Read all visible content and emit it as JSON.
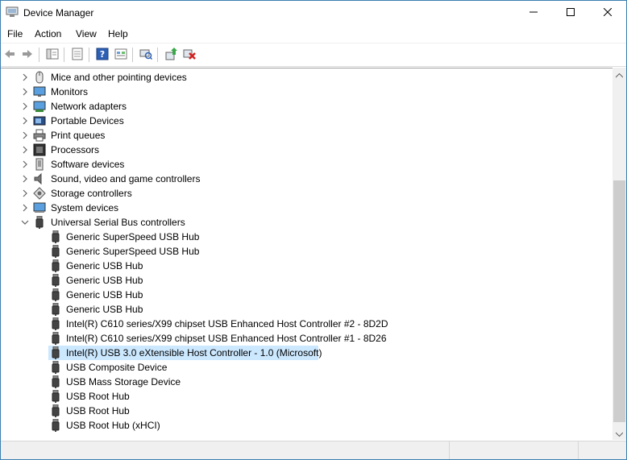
{
  "window": {
    "title": "Device Manager"
  },
  "menu": {
    "items": [
      "File",
      "Action",
      "View",
      "Help"
    ]
  },
  "toolbar": {
    "buttons": [
      "back-icon",
      "forward-icon",
      "show-hide-tree-icon",
      "properties-icon",
      "help-icon",
      "show-hidden-icon",
      "scan-hardware-icon",
      "update-driver-icon",
      "uninstall-device-icon"
    ]
  },
  "tree": {
    "categories": [
      {
        "label": "Mice and other pointing devices",
        "icon": "mouse-icon"
      },
      {
        "label": "Monitors",
        "icon": "monitor-icon"
      },
      {
        "label": "Network adapters",
        "icon": "network-icon"
      },
      {
        "label": "Portable Devices",
        "icon": "portable-icon"
      },
      {
        "label": "Print queues",
        "icon": "printer-icon"
      },
      {
        "label": "Processors",
        "icon": "processor-icon"
      },
      {
        "label": "Software devices",
        "icon": "software-icon"
      },
      {
        "label": "Sound, video and game controllers",
        "icon": "speaker-icon"
      },
      {
        "label": "Storage controllers",
        "icon": "storage-icon"
      },
      {
        "label": "System devices",
        "icon": "system-icon"
      },
      {
        "label": "Universal Serial Bus controllers",
        "icon": "usb-icon",
        "expanded": true
      }
    ],
    "usb_children": [
      {
        "label": "Generic SuperSpeed USB Hub"
      },
      {
        "label": "Generic SuperSpeed USB Hub"
      },
      {
        "label": "Generic USB Hub"
      },
      {
        "label": "Generic USB Hub"
      },
      {
        "label": "Generic USB Hub"
      },
      {
        "label": "Generic USB Hub"
      },
      {
        "label": "Intel(R) C610 series/X99 chipset USB Enhanced Host Controller #2 - 8D2D"
      },
      {
        "label": "Intel(R) C610 series/X99 chipset USB Enhanced Host Controller #1 - 8D26"
      },
      {
        "label": "Intel(R) USB 3.0 eXtensible Host Controller - 1.0 (Microsoft)",
        "selected": true
      },
      {
        "label": "USB Composite Device"
      },
      {
        "label": "USB Mass Storage Device"
      },
      {
        "label": "USB Root Hub"
      },
      {
        "label": "USB Root Hub"
      },
      {
        "label": "USB Root Hub (xHCI)"
      }
    ]
  },
  "colors": {
    "selection": "#cce8ff",
    "window_border": "#3c7fb1"
  }
}
